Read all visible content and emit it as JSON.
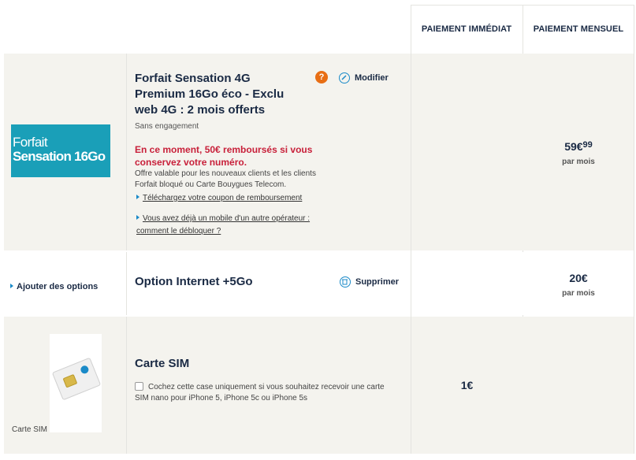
{
  "header": {
    "col_immediate": "PAIEMENT IMMÉDIAT",
    "col_monthly": "PAIEMENT MENSUEL"
  },
  "plan": {
    "logo_line1": "Forfait",
    "logo_line2": "Sensation 16Go",
    "title": "Forfait Sensation 4G Premium 16Go éco - Exclu web 4G : 2 mois offerts",
    "help_icon": "?",
    "modify_label": "Modifier",
    "commitment": "Sans engagement",
    "promo": "En ce moment, 50€ remboursés si vous conservez votre numéro.",
    "offer_text": "Offre valable pour les nouveaux clients et les clients Forfait bloqué ou Carte Bouygues Telecom.",
    "coupon_link": "Téléchargez votre coupon de remboursement",
    "unlock_link": "Vous avez déjà un mobile d'un autre opérateur : comment le débloquer ?",
    "price_main": "59€",
    "price_cents": "99",
    "price_period": "par mois"
  },
  "option": {
    "add_options_label": "Ajouter des options",
    "title": "Option Internet +5Go",
    "delete_label": "Supprimer",
    "price": "20€",
    "price_period": "par mois"
  },
  "sim": {
    "caption": "Carte SIM",
    "title": "Carte SIM",
    "checkbox_label": "Cochez cette case uniquement si vous souhaitez recevoir une carte SIM nano pour iPhone 5, iPhone 5c ou iPhone 5s",
    "checkbox_checked": false,
    "price_immediate": "1€"
  },
  "colors": {
    "brand_teal": "#1a9fb8",
    "promo_red": "#c8203a",
    "help_orange": "#e86e14",
    "link_blue": "#1a8ac8"
  }
}
